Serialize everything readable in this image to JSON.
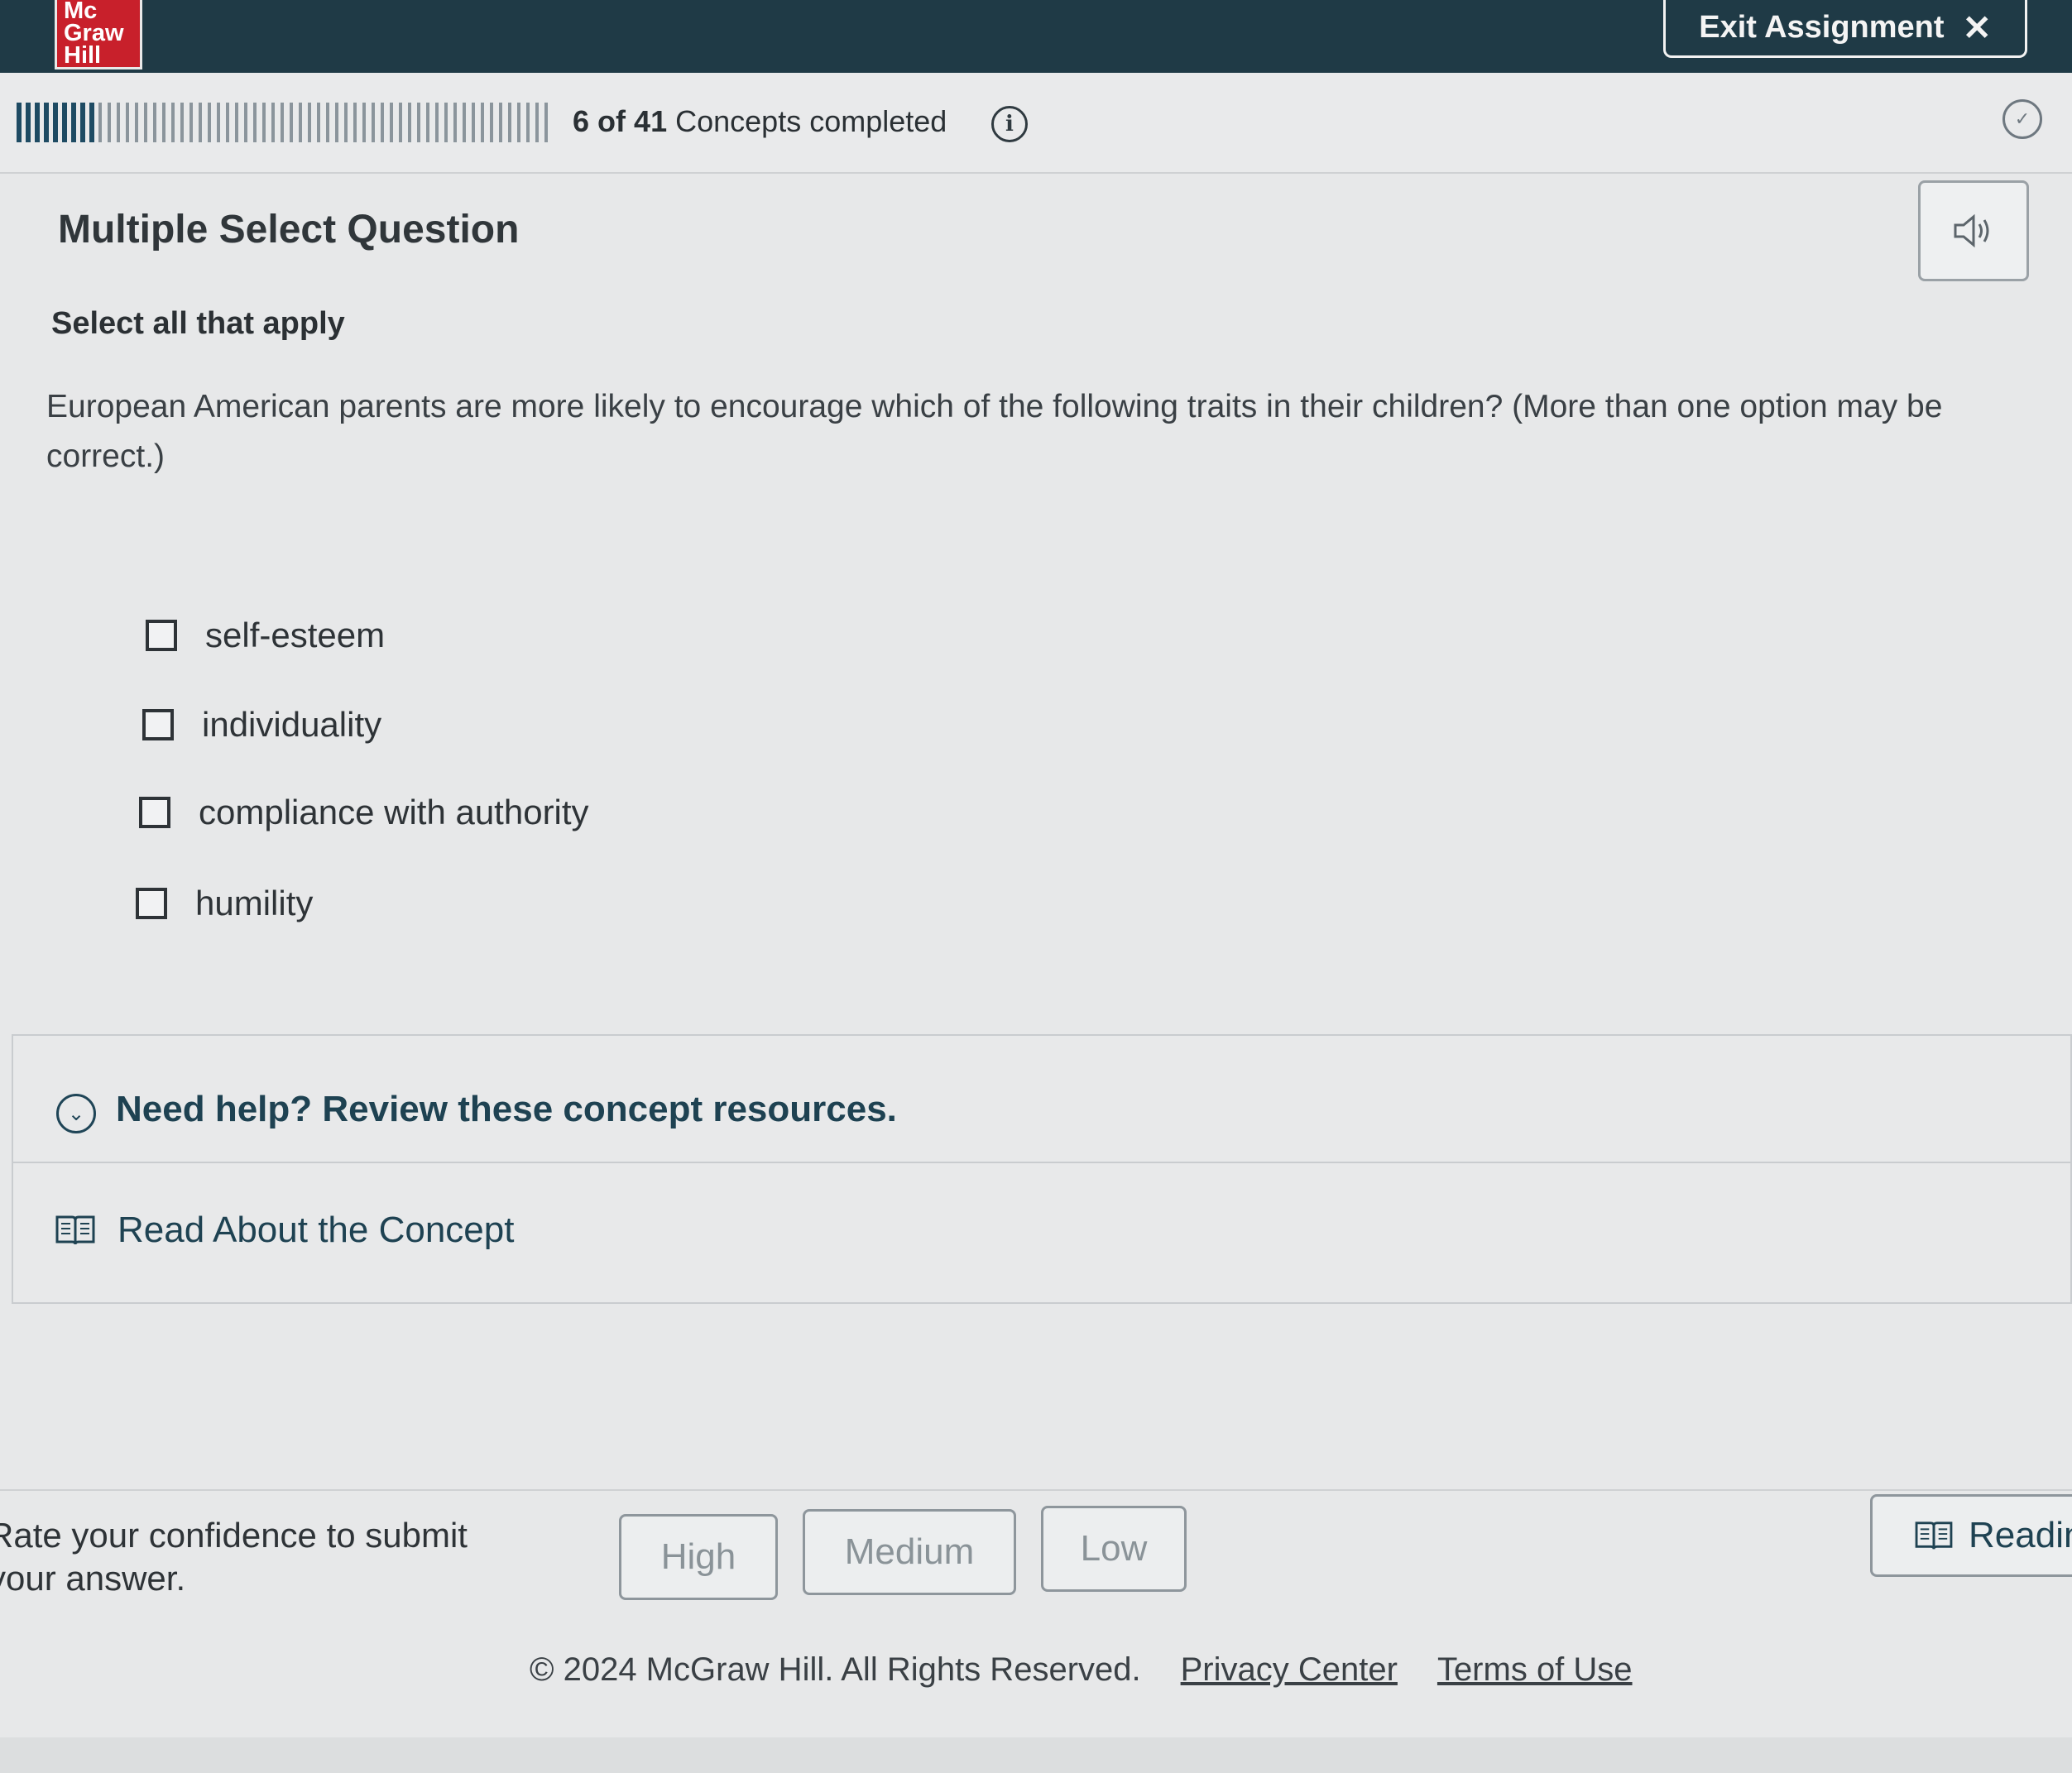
{
  "header": {
    "logo_lines": [
      "Mc",
      "Graw",
      "Hill"
    ],
    "exit_label": "Exit Assignment",
    "exit_icon": "close-icon"
  },
  "progress": {
    "completed": "6",
    "total": "41",
    "of_word": "of",
    "suffix": "Concepts completed",
    "fraction_complete": 0.146
  },
  "question": {
    "type_title": "Multiple Select Question",
    "instruction": "Select all that apply",
    "prompt": "European American parents are more likely to encourage which of the following traits in their children? (More than one option may be correct.)",
    "options": [
      {
        "label": "self-esteem",
        "checked": false
      },
      {
        "label": "individuality",
        "checked": false
      },
      {
        "label": "compliance with authority",
        "checked": false
      },
      {
        "label": "humility",
        "checked": false
      }
    ]
  },
  "help": {
    "title": "Need help? Review these concept resources.",
    "read_label": "Read About the Concept"
  },
  "confidence": {
    "prompt_line1": "Rate your confidence to submit",
    "prompt_line2": "your answer.",
    "buttons": [
      "High",
      "Medium",
      "Low"
    ],
    "reading_label": "Readin"
  },
  "footer": {
    "copyright": "© 2024 McGraw Hill. All Rights Reserved.",
    "privacy": "Privacy Center",
    "terms": "Terms of Use"
  },
  "colors": {
    "header_bg": "#1f3a46",
    "brand_red": "#c8202b",
    "accent_text": "#1e4252"
  }
}
